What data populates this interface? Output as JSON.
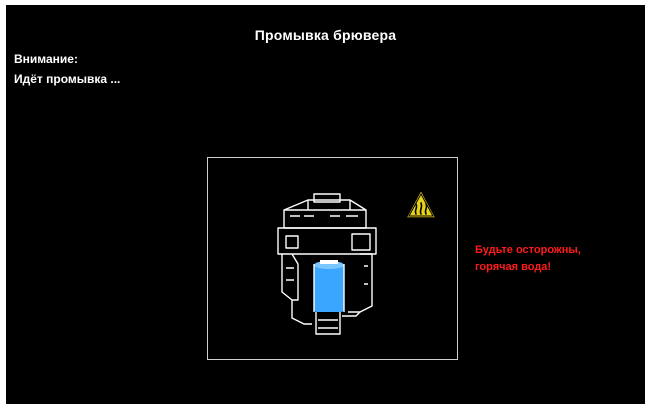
{
  "screen": {
    "title": "Промывка брювера",
    "notice_heading": "Внимание:",
    "notice_text": "Идёт промывка ...",
    "warning_line1": "Будьте осторожны,",
    "warning_line2": "горячая вода!"
  },
  "icons": {
    "illustration": "brewer-unit-icon",
    "hazard": "hot-water-hazard-icon"
  },
  "colors": {
    "background": "#000000",
    "text": "#ffffff",
    "warning": "#ff1a1a",
    "water": "#3aa6ff",
    "hazard_fill": "#e8d21a"
  }
}
